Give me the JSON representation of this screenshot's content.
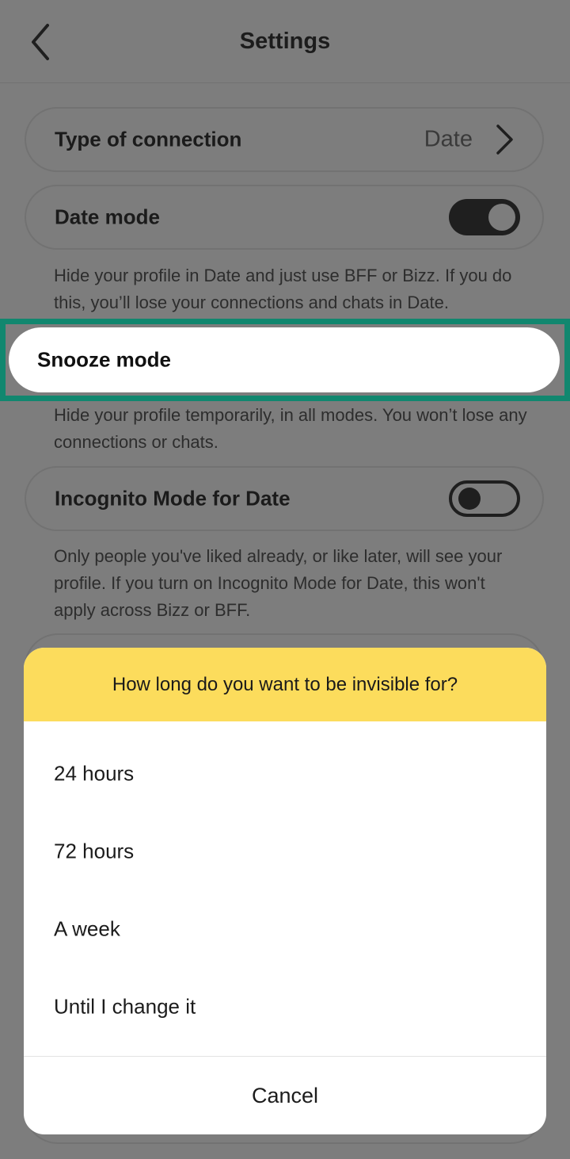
{
  "header": {
    "title": "Settings"
  },
  "type_of_connection": {
    "label": "Type of connection",
    "value": "Date"
  },
  "date_mode": {
    "label": "Date mode",
    "enabled": true,
    "description": "Hide your profile in Date and just use BFF or Bizz. If you do this, you’ll lose your connections and chats in Date."
  },
  "snooze_mode": {
    "label": "Snooze mode",
    "description": "Hide your profile temporarily, in all modes. You won’t lose any connections or chats."
  },
  "incognito": {
    "label": "Incognito Mode for Date",
    "enabled": false,
    "description": "Only people you've liked already, or like later, will see your profile. If you turn on Incognito Mode for Date, this won't apply across Bizz or BFF."
  },
  "sheet": {
    "title": "How long do you want to be invisible for?",
    "options": [
      "24 hours",
      "72 hours",
      "A week",
      "Until I change it"
    ],
    "cancel": "Cancel"
  },
  "colors": {
    "accent": "#fcdc5c",
    "highlight": "#11876f",
    "overlay": "#7d7d7d"
  }
}
